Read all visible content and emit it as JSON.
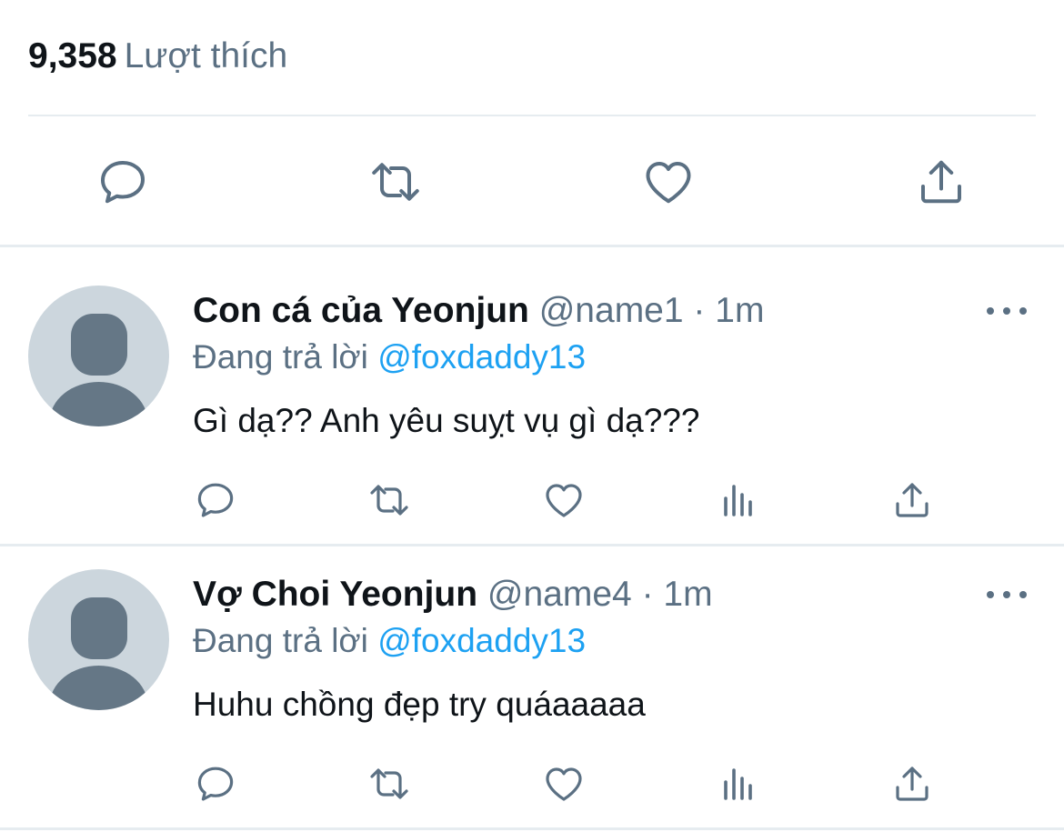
{
  "tweet": {
    "likes_count": "9,358",
    "likes_label": "Lượt thích",
    "actions": [
      "reply-icon",
      "retweet-icon",
      "like-icon",
      "share-icon"
    ]
  },
  "replies": [
    {
      "name": "Con cá của Yeonjun",
      "handle": "@name1",
      "separator": "·",
      "time": "1m",
      "replying_label": "Đang trả lời",
      "replying_to": "@foxdaddy13",
      "text": "Gì dạ?? Anh yêu suỵt vụ gì dạ???"
    },
    {
      "name": "Vợ Choi Yeonjun",
      "handle": "@name4",
      "separator": "·",
      "time": "1m",
      "replying_label": "Đang trả lời",
      "replying_to": "@foxdaddy13",
      "text": "Huhu chồng đẹp try quáaaaaa"
    }
  ],
  "colors": {
    "text_primary": "#0f1419",
    "text_secondary": "#5b7083",
    "link": "#1da1f2",
    "divider": "#e6ecf0",
    "avatar_bg": "#ccd6dd",
    "avatar_fg": "#657786"
  }
}
